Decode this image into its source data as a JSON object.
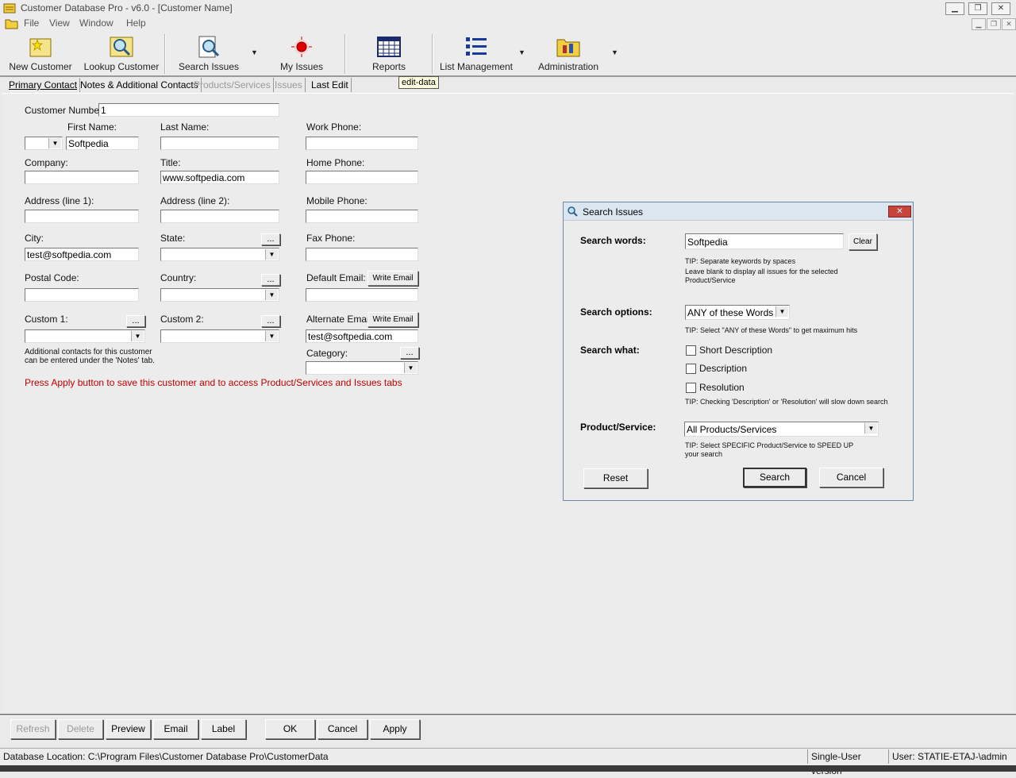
{
  "window": {
    "title": "Customer Database Pro - v6.0 - [Customer Name]"
  },
  "menu": [
    "File",
    "View",
    "Window",
    "Help"
  ],
  "toolbar": {
    "new_customer": "New Customer",
    "lookup_customer": "Lookup Customer",
    "search_issues": "Search Issues",
    "my_issues": "My Issues",
    "reports": "Reports",
    "list_management": "List Management",
    "administration": "Administration",
    "dropdown_arrow": "▼"
  },
  "tabs": [
    {
      "label": "Primary Contact",
      "enabled": true
    },
    {
      "label": "Notes & Additional Contacts",
      "enabled": true
    },
    {
      "label": "Products/Services",
      "enabled": false
    },
    {
      "label": "Issues",
      "enabled": false
    },
    {
      "label": "Last Edit",
      "enabled": true
    }
  ],
  "tooltip": "edit-data",
  "form": {
    "customer_number_label": "Customer Number:",
    "customer_number": "1",
    "first_name_label": "First Name:",
    "first_name": "Softpedia",
    "last_name_label": "Last Name:",
    "last_name": "",
    "work_phone_label": "Work Phone:",
    "company_label": "Company:",
    "title_label": "Title:",
    "title": "www.softpedia.com",
    "home_phone_label": "Home Phone:",
    "address1_label": "Address (line 1):",
    "address2_label": "Address (line 2):",
    "mobile_phone_label": "Mobile Phone:",
    "city_label": "City:",
    "city": "test@softpedia.com",
    "state_label": "State:",
    "fax_phone_label": "Fax Phone:",
    "postal_code_label": "Postal Code:",
    "country_label": "Country:",
    "default_email_label": "Default Email:",
    "write_email": "Write Email",
    "custom1_label": "Custom 1:",
    "custom2_label": "Custom 2:",
    "alternate_email_label": "Alternate Email:",
    "alternate_email": "test@softpedia.com",
    "category_label": "Category:",
    "ellipsis": "...",
    "additional_note_1": "Additional contacts for this customer",
    "additional_note_2": "can be entered under the 'Notes' tab.",
    "apply_notice": "Press Apply button to save this customer and to access Product/Services and Issues tabs",
    "apply_notice_color": "#c00000"
  },
  "dialog": {
    "title": "Search Issues",
    "search_words_label": "Search words:",
    "search_words": "Softpedia",
    "clear": "Clear",
    "tip_words_1": "TIP: Separate keywords by spaces",
    "tip_words_2": "Leave blank to display all issues for the selected",
    "tip_words_3": "Product/Service",
    "search_options_label": "Search options:",
    "search_option": "ANY of these Words",
    "tip_options": "TIP: Select \"ANY of these Words\" to get maximum hits",
    "search_what_label": "Search what:",
    "checkboxes": [
      "Short Description",
      "Description",
      "Resolution"
    ],
    "tip_what": "TIP: Checking 'Description' or 'Resolution' will slow down search",
    "product_label": "Product/Service:",
    "product_value": "All Products/Services",
    "tip_product_1": "TIP: Select SPECIFIC Product/Service to SPEED UP",
    "tip_product_2": "your search",
    "reset": "Reset",
    "search": "Search",
    "cancel": "Cancel"
  },
  "bottom_buttons": {
    "refresh": "Refresh",
    "delete": "Delete",
    "preview": "Preview",
    "email": "Email",
    "label": "Label",
    "ok": "OK",
    "cancel": "Cancel",
    "apply": "Apply"
  },
  "status": {
    "db_location": "Database Location: C:\\Program Files\\Customer Database Pro\\CustomerData",
    "version": "Single-User version",
    "user": "User: STATIE-ETAJ-\\admin"
  }
}
